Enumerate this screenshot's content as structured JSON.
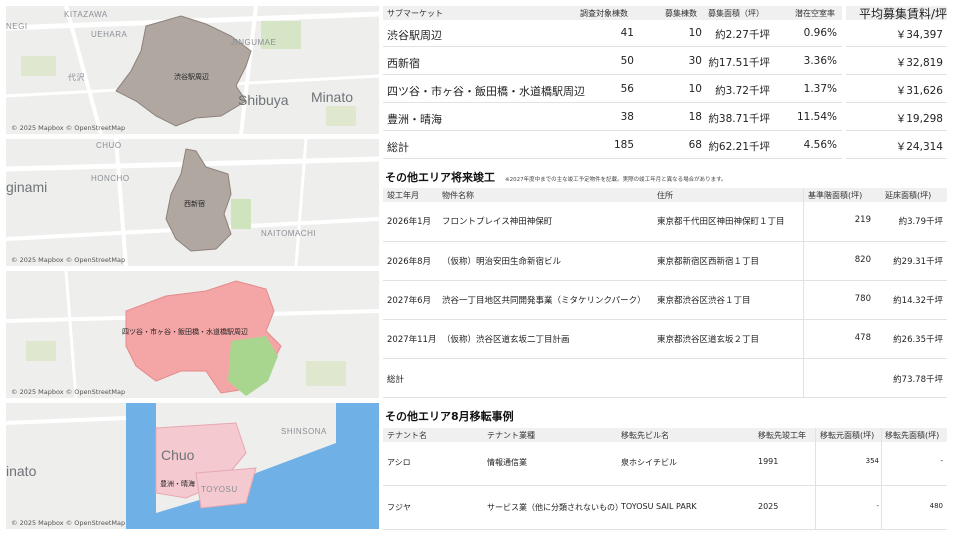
{
  "maps": [
    {
      "attribution": "© 2025 Mapbox © OpenStreetMap",
      "area_label": "渋谷駅周辺",
      "labels": [
        "KITAZAWA",
        "UEHARA",
        "JINGUMAE",
        "NEGI",
        "代沢",
        "Shibuya",
        "Minato"
      ]
    },
    {
      "attribution": "© 2025 Mapbox © OpenStreetMap",
      "area_label": "西新宿",
      "labels": [
        "CHUO",
        "HONCHO",
        "ginami",
        "NAITOMACHI"
      ]
    },
    {
      "attribution": "© 2025 Mapbox © OpenStreetMap",
      "area_label": "四ツ谷・市ヶ谷・飯田橋・水道橋駅周辺",
      "labels": []
    },
    {
      "attribution": "© 2025 Mapbox © OpenStreetMap",
      "area_label": "豊洲・晴海",
      "labels": [
        "SHINSONA",
        "Chuo",
        "inato",
        "TOYOSU"
      ]
    }
  ],
  "submarket": {
    "headers": [
      "サブマーケット",
      "調査対象棟数",
      "募集棟数",
      "募集面積（坪）",
      "潜在空室率",
      "平均募集賃料/坪"
    ],
    "rows": [
      {
        "name": "渋谷駅周辺",
        "surveyed": "41",
        "listed": "10",
        "area": "約2.27千坪",
        "vacancy": "0.96%",
        "rent": "￥34,397"
      },
      {
        "name": "西新宿",
        "surveyed": "50",
        "listed": "30",
        "area": "約17.51千坪",
        "vacancy": "3.36%",
        "rent": "￥32,819"
      },
      {
        "name": "四ツ谷・市ヶ谷・飯田橋・水道橋駅周辺",
        "surveyed": "56",
        "listed": "10",
        "area": "約3.72千坪",
        "vacancy": "1.37%",
        "rent": "￥31,626"
      },
      {
        "name": "豊洲・晴海",
        "surveyed": "38",
        "listed": "18",
        "area": "約38.71千坪",
        "vacancy": "11.54%",
        "rent": "￥19,298"
      },
      {
        "name": "総計",
        "surveyed": "185",
        "listed": "68",
        "area": "約62.21千坪",
        "vacancy": "4.56%",
        "rent": "￥24,314"
      }
    ]
  },
  "future": {
    "title": "その他エリア将来竣工",
    "note": "※2027年度中までの主な竣工予定物件を記載。実際の竣工年月と異なる場合があります。",
    "headers": [
      "竣工年月",
      "物件名称",
      "住所",
      "基準階面積(坪)",
      "延床面積(坪)"
    ],
    "rows": [
      {
        "date": "2026年1月",
        "name": "フロントプレイス神田神保町",
        "addr": "東京都千代田区神田神保町１丁目",
        "floor": "219",
        "total": "約3.79千坪"
      },
      {
        "date": "2026年8月",
        "name": "（仮称）明治安田生命新宿ビル",
        "addr": "東京都新宿区西新宿１丁目",
        "floor": "820",
        "total": "約29.31千坪"
      },
      {
        "date": "2027年6月",
        "name": "渋谷一丁目地区共同開発事業（ミタケリンクパーク）",
        "addr": "東京都渋谷区渋谷１丁目",
        "floor": "780",
        "total": "約14.32千坪"
      },
      {
        "date": "2027年11月",
        "name": "（仮称）渋谷区道玄坂二丁目計画",
        "addr": "東京都渋谷区道玄坂２丁目",
        "floor": "478",
        "total": "約26.35千坪"
      },
      {
        "date": "総計",
        "name": "",
        "addr": "",
        "floor": "",
        "total": "約73.78千坪"
      }
    ]
  },
  "relocation": {
    "title": "その他エリア8月移転事例",
    "headers": [
      "テナント名",
      "テナント業種",
      "移転先ビル名",
      "移転先竣工年",
      "移転元面積(坪)",
      "移転先面積(坪)"
    ],
    "rows": [
      {
        "tenant": "アシロ",
        "industry": "情報通信業",
        "building": "泉ホシイチビル",
        "year": "1991",
        "from": "354",
        "to": "-"
      },
      {
        "tenant": "フジヤ",
        "industry": "サービス業（他に分類されないもの）",
        "building": "TOYOSU SAIL PARK",
        "year": "2025",
        "from": "-",
        "to": "480"
      }
    ]
  }
}
